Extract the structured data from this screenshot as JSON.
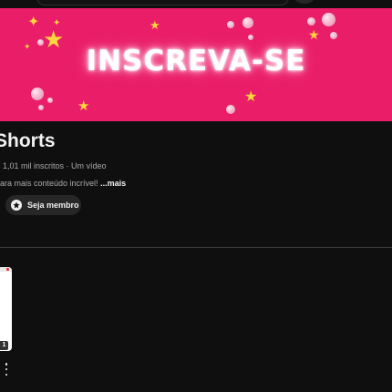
{
  "banner": {
    "text": "INSCREVA-SE"
  },
  "channel": {
    "title": "Shorts",
    "meta": "1,01 mil inscritos · Um vídeo",
    "description": "ara mais conteúdo incrível!",
    "more_label": "...mais"
  },
  "join_button": {
    "label": "Seja membro",
    "icon": "star-circle-icon"
  },
  "video": {
    "badge": "1"
  },
  "colors": {
    "background": "#0f0f0f",
    "banner": "#ea1e68",
    "star": "#ffd53d",
    "button": "#272727"
  }
}
